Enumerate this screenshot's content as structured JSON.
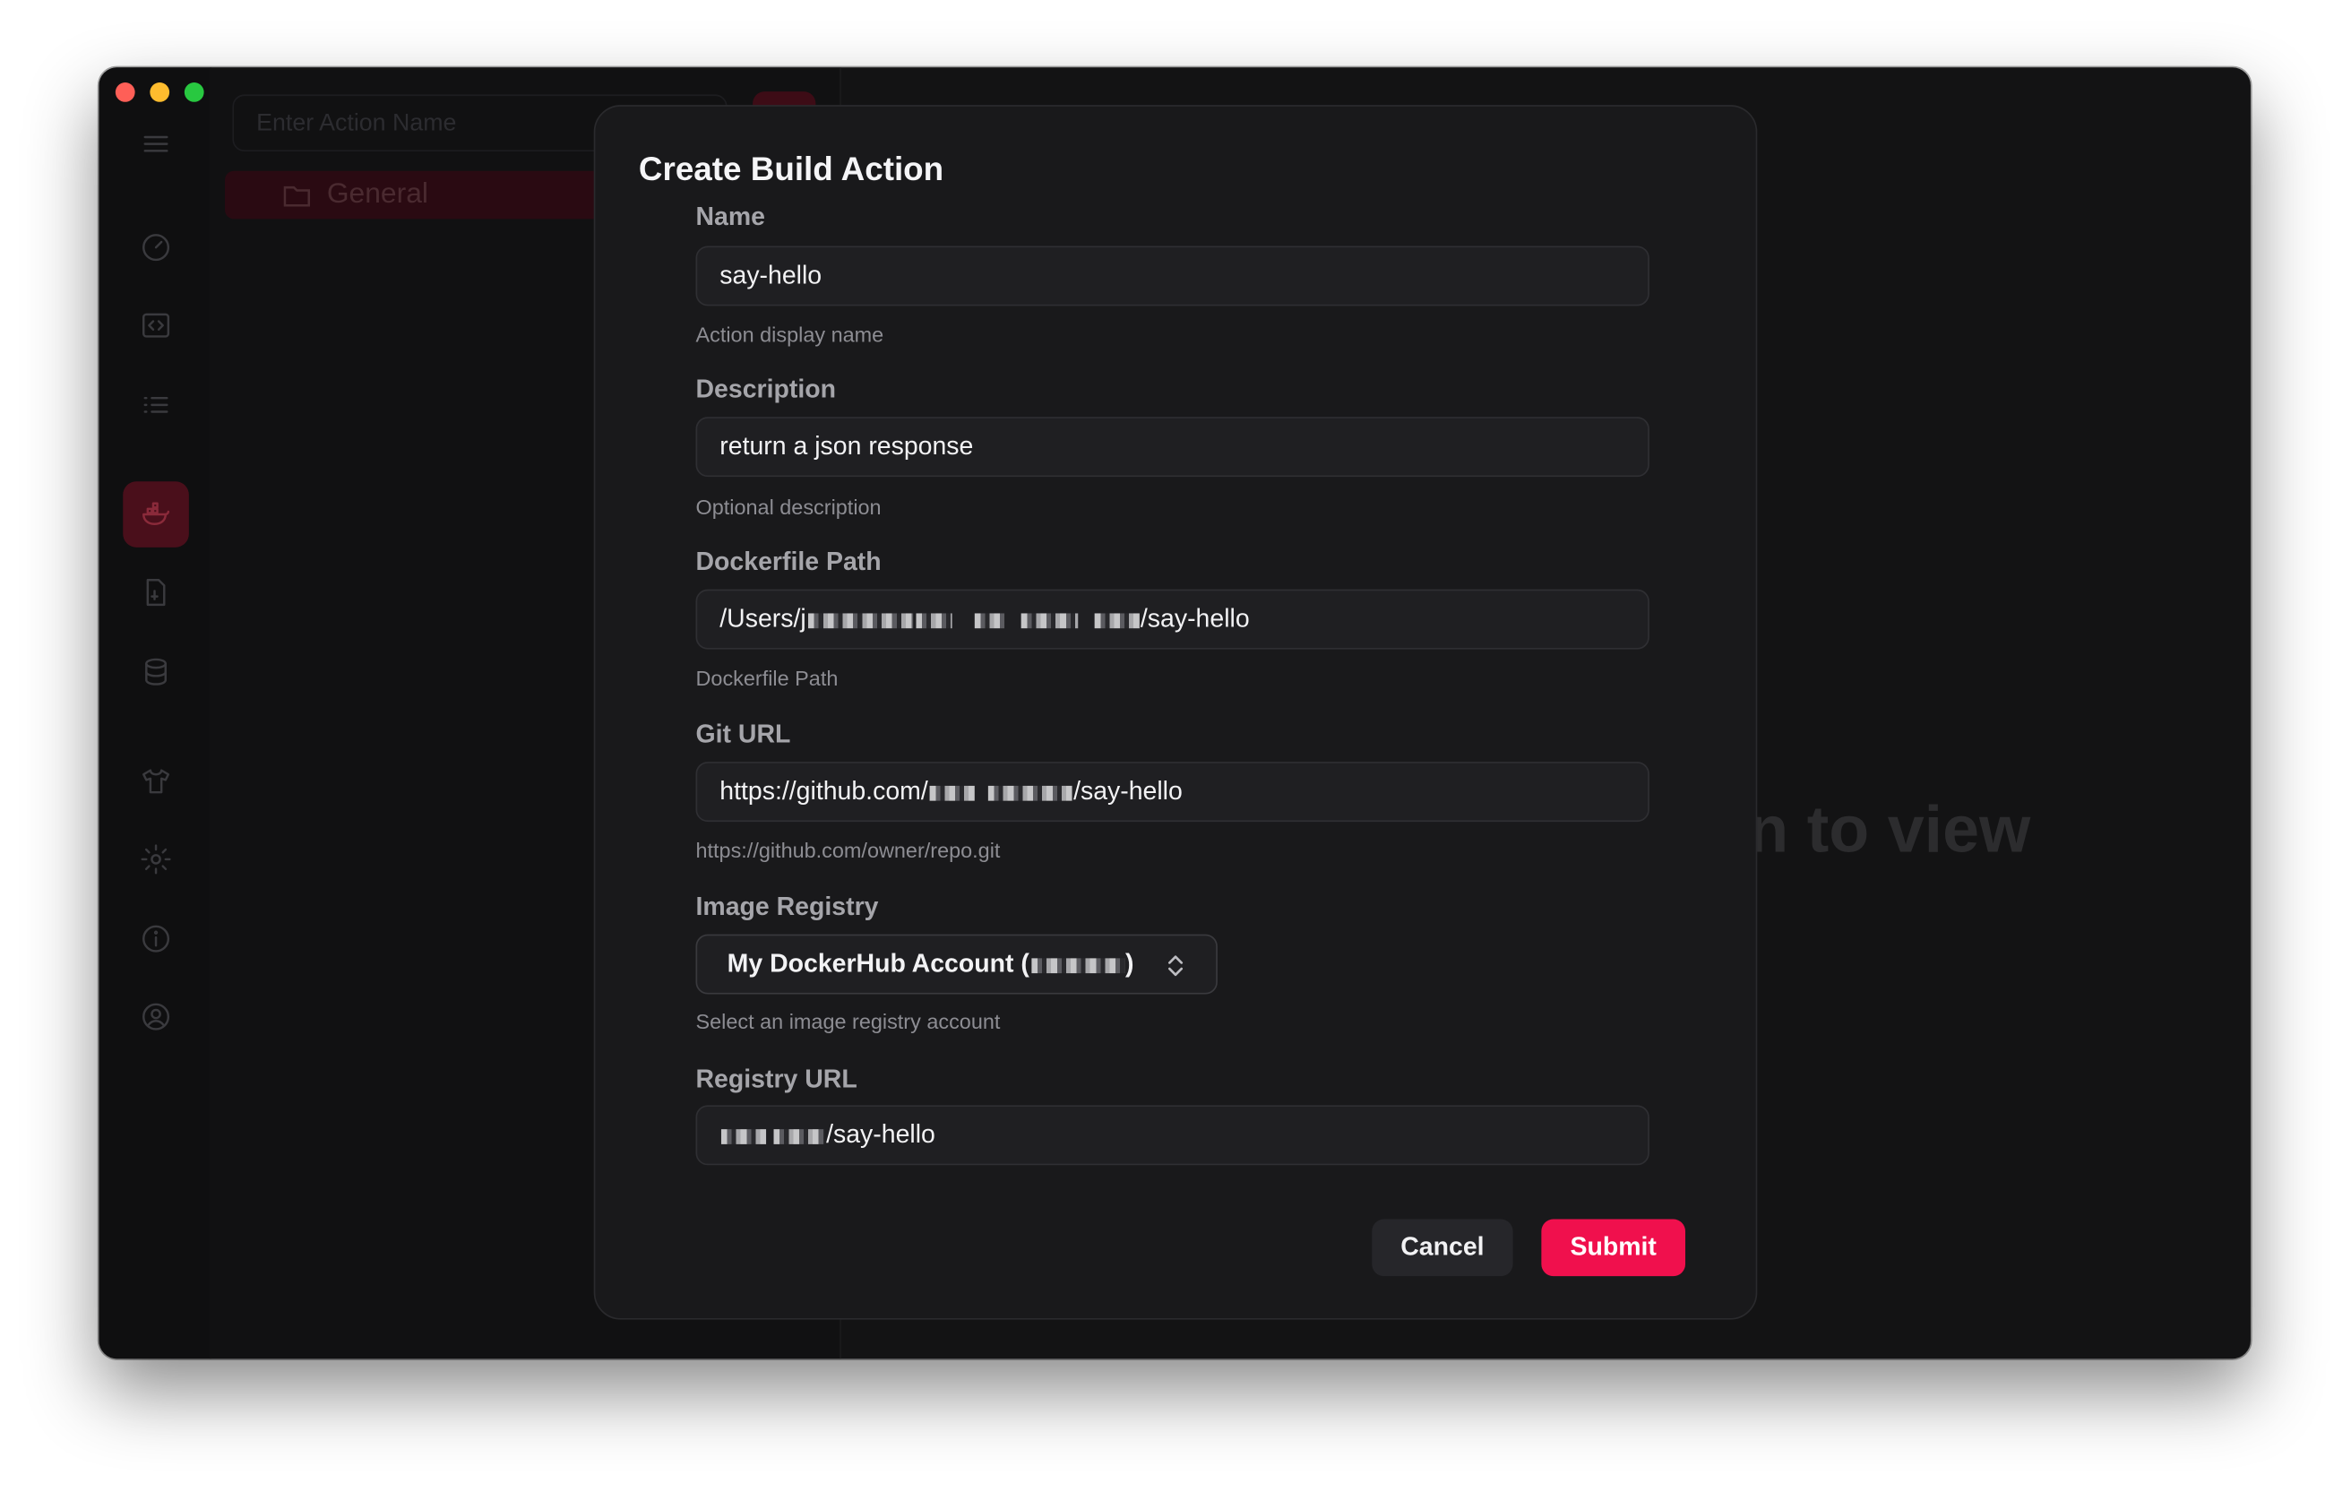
{
  "background_panel": {
    "search_placeholder": "Enter Action Name",
    "folder_label": "General",
    "content_hint": "n to view"
  },
  "sidebar": {
    "icons": [
      "menu-icon",
      "dashboard-icon",
      "code-icon",
      "list-icon",
      "docker-icon",
      "file-icon",
      "database-icon",
      "shirt-icon",
      "gear-icon",
      "info-icon",
      "user-icon"
    ],
    "active": "docker-icon"
  },
  "dialog": {
    "title": "Create Build Action",
    "fields": {
      "name": {
        "label": "Name",
        "value": "say-hello",
        "help": "Action display name"
      },
      "description": {
        "label": "Description",
        "value": "return a json response",
        "help": "Optional description"
      },
      "dockerfile_path": {
        "label": "Dockerfile Path",
        "value_prefix": "/Users/j",
        "value_suffix": "/say-hello",
        "help": "Dockerfile Path"
      },
      "git_url": {
        "label": "Git URL",
        "value_prefix": "https://github.com/",
        "value_suffix": "/say-hello",
        "help": "https://github.com/owner/repo.git"
      },
      "image_registry": {
        "label": "Image Registry",
        "value_prefix": "My DockerHub Account (",
        "value_suffix": ")",
        "help": "Select an image registry account"
      },
      "registry_url": {
        "label": "Registry URL",
        "value_suffix": "/say-hello"
      }
    },
    "buttons": {
      "cancel": "Cancel",
      "submit": "Submit"
    }
  },
  "colors": {
    "accent": "#f0104d",
    "dialog_bg": "#19191b",
    "window_bg": "#131314"
  }
}
